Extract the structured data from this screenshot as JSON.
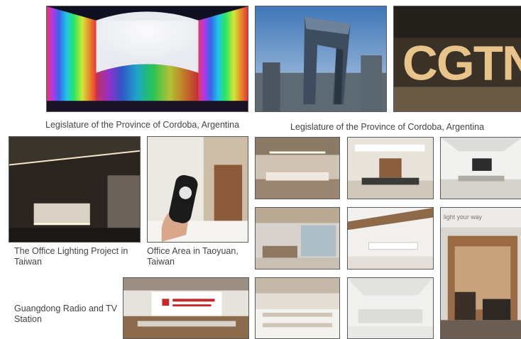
{
  "captions": {
    "cordoba_left": "Legislature of the Province of Cordoba, Argentina",
    "cordoba_right": "Legislature of the Province of Cordoba, Argentina",
    "office_taiwan": "The Office Lighting Project in Taiwan",
    "taoyuan": "Office Area in Taoyuan, Taiwan",
    "guangdong": "Guangdong Radio and TV Station"
  },
  "photos": {
    "cctv_sign": "CGTN",
    "office_wall_text": "light your way"
  },
  "colors": {
    "frame": "#5a5a5a",
    "caption": "#444444",
    "background": "#ffffff"
  }
}
